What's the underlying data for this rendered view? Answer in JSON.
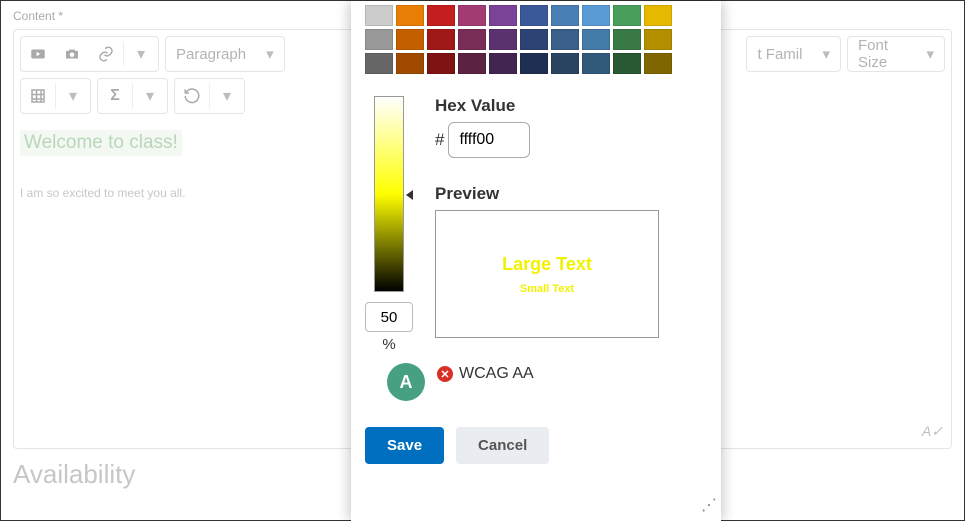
{
  "background": {
    "content_label": "Content *",
    "paragraph_label": "Paragraph",
    "font_family_label": "t Famil",
    "font_size_label": "Font Size",
    "heading_text": "Welcome to class!",
    "body_text": "I am so excited to meet you all.",
    "accessibility_badge": "A✓",
    "availability_heading": "Availability"
  },
  "dialog": {
    "swatch_colors": [
      "#cccccc",
      "#e87e04",
      "#c41e1e",
      "#a23b72",
      "#7b4397",
      "#3b5998",
      "#4a7fb5",
      "#5b9bd5",
      "#4a9e5c",
      "#e6b800",
      "#999999",
      "#c45f00",
      "#a01818",
      "#7a2d56",
      "#5b3270",
      "#2d4373",
      "#395f8a",
      "#447aa8",
      "#397a47",
      "#b38f00",
      "#666666",
      "#a04a00",
      "#7d1313",
      "#5c2241",
      "#432552",
      "#1f2f52",
      "#294562",
      "#31597a",
      "#295933",
      "#806600"
    ],
    "hex_label": "Hex Value",
    "hash": "#",
    "hex_value": "ffff00",
    "brightness_value": "50",
    "brightness_unit": "%",
    "preview_label": "Preview",
    "large_text": "Large Text",
    "small_text": "Small Text",
    "badge_a": "A",
    "error_glyph": "✕",
    "wcag_text": "WCAG AA",
    "save_label": "Save",
    "cancel_label": "Cancel",
    "resize_glyph": "⋰"
  }
}
